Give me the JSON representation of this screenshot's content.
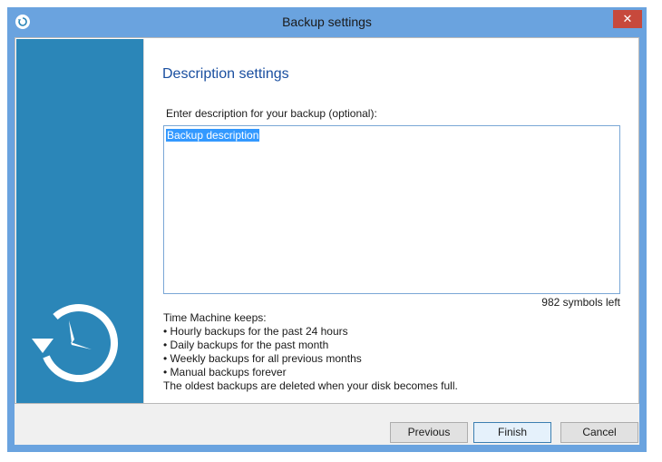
{
  "window": {
    "title": "Backup settings",
    "close_symbol": "✕"
  },
  "icons": {
    "app": "time-machine-icon",
    "side_panel": "time-machine-clock-icon",
    "close": "close-icon"
  },
  "colors": {
    "titlebar": "#6aa3df",
    "side_panel": "#2b86b8",
    "close_button": "#c7493c",
    "heading": "#1a4fa0",
    "selection": "#3399ff"
  },
  "content": {
    "section_title": "Description settings",
    "prompt_label": "Enter description for your backup (optional):",
    "description_value": "Backup description",
    "symbols_left": "982 symbols left",
    "keeps_header": "Time Machine keeps:",
    "keeps_items": [
      "• Hourly backups for the past 24 hours",
      "• Daily backups for the past month",
      "• Weekly backups for all previous months",
      "• Manual backups forever"
    ],
    "keeps_footer": "The oldest backups are deleted when your disk becomes full."
  },
  "buttons": {
    "previous": "Previous",
    "finish": "Finish",
    "cancel": "Cancel"
  }
}
